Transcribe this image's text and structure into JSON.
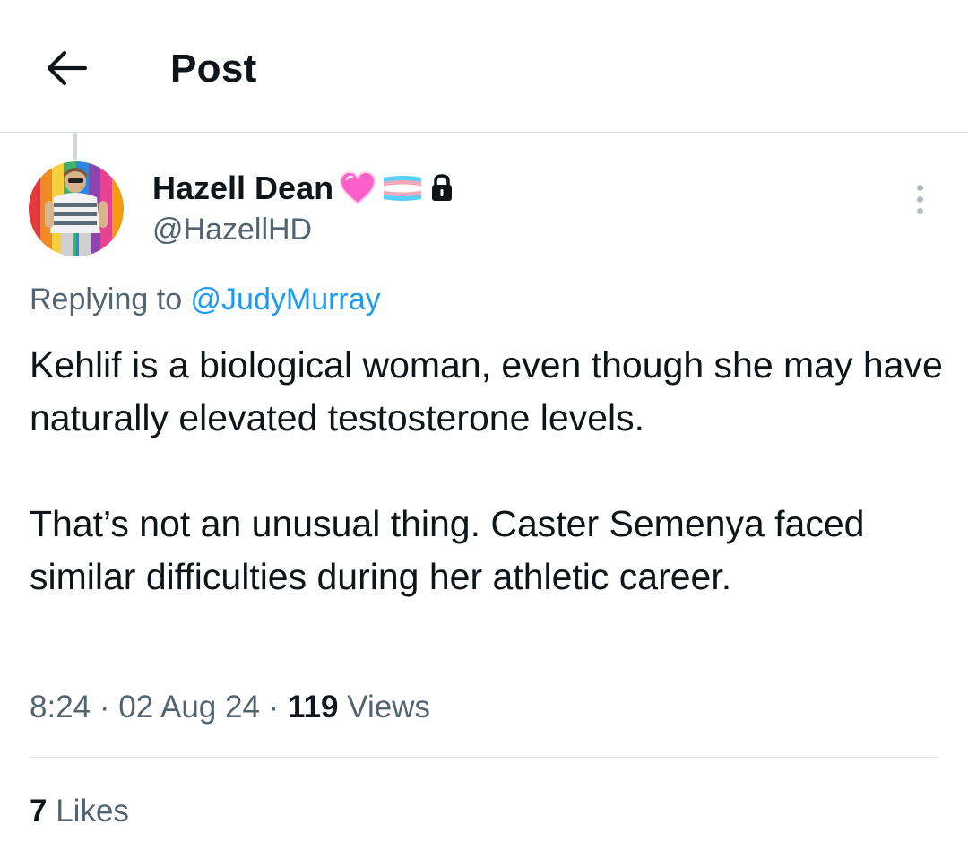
{
  "header": {
    "back_icon": "arrow-left-icon",
    "title": "Post"
  },
  "author": {
    "display_name": "Hazell Dean",
    "badges": [
      "pink-heart-icon",
      "transgender-flag-icon",
      "lock-icon"
    ],
    "handle": "@HazellHD"
  },
  "reply": {
    "prefix": "Replying to ",
    "mention": "@JudyMurray"
  },
  "tweet": {
    "paragraphs": [
      "Kehlif is a biological woman, even though she may have naturally  elevated testosterone levels.",
      "That’s not an unusual thing. Caster Semenya faced similar difficulties during her athletic career."
    ]
  },
  "meta": {
    "time": "8:24",
    "date": "02 Aug 24",
    "separator": "·",
    "views_count": "119",
    "views_label": "Views"
  },
  "engagement": {
    "likes_count": "7",
    "likes_label": "Likes"
  },
  "colors": {
    "text": "#0f1419",
    "secondary": "#536471",
    "link": "#1d9bf0",
    "divider": "#e1e6ea"
  }
}
